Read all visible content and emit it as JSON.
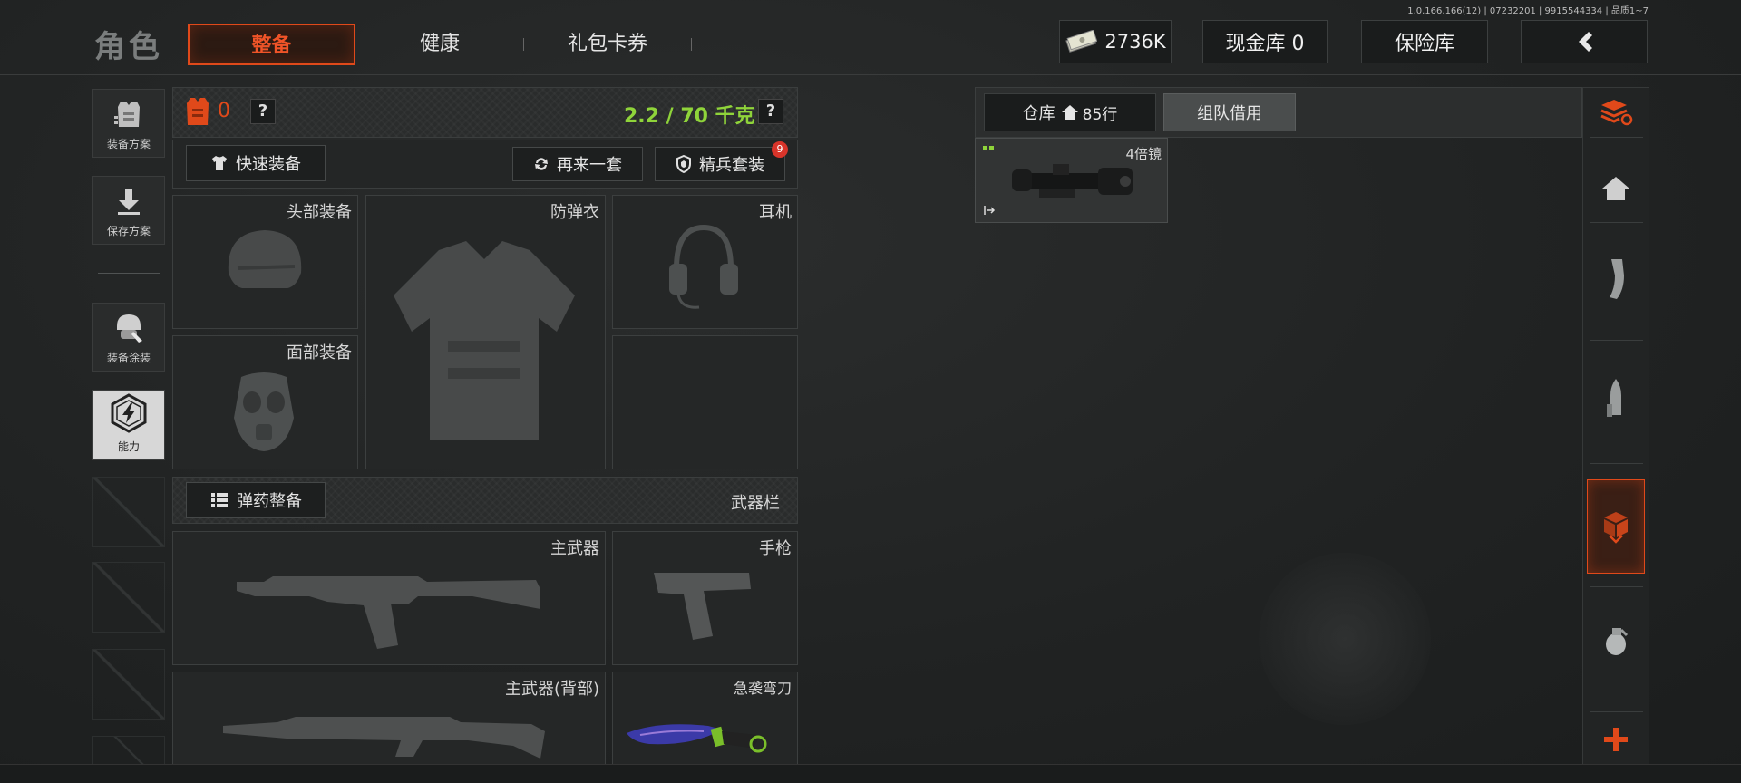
{
  "version": "1.0.166.166(12) | 07232201 | 9915544334 | 品质1~7",
  "header": {
    "title": "角色",
    "tabs": [
      {
        "label": "整备",
        "active": true
      },
      {
        "label": "健康",
        "active": false
      },
      {
        "label": "礼包卡券",
        "active": false
      }
    ],
    "currency": "2736K",
    "cash_vault": "现金库 0",
    "safe_vault": "保险库"
  },
  "sidebar": {
    "items": [
      {
        "label": "装备方案",
        "icon": "vest-stack-icon"
      },
      {
        "label": "保存方案",
        "icon": "download-icon"
      },
      {
        "label": "装备涂装",
        "icon": "helmet-paint-icon"
      },
      {
        "label": "能力",
        "icon": "lightning-hex-icon",
        "active": true
      }
    ]
  },
  "loadout": {
    "armor_count": "0",
    "help": "?",
    "weight": "2.2 / 70 千克",
    "quick_equip": "快速装备",
    "redo": "再来一套",
    "elite_set": "精兵套装",
    "elite_badge": "9",
    "slots": {
      "head": "头部装备",
      "vest": "防弹衣",
      "headset": "耳机",
      "face": "面部装备"
    },
    "ammo_button": "弹药整备",
    "weapon_bar": "武器栏",
    "weapons": {
      "primary": "主武器",
      "pistol": "手枪",
      "primary_back": "主武器(背部)",
      "knife": "急袭弯刀"
    }
  },
  "warehouse": {
    "tab_storage": "仓库",
    "rows": "85行",
    "tab_team": "组队借用",
    "item_name": "4倍镜"
  },
  "colors": {
    "accent": "#e0491a",
    "weight_green": "#8fd43a",
    "badge_red": "#d8342a"
  }
}
